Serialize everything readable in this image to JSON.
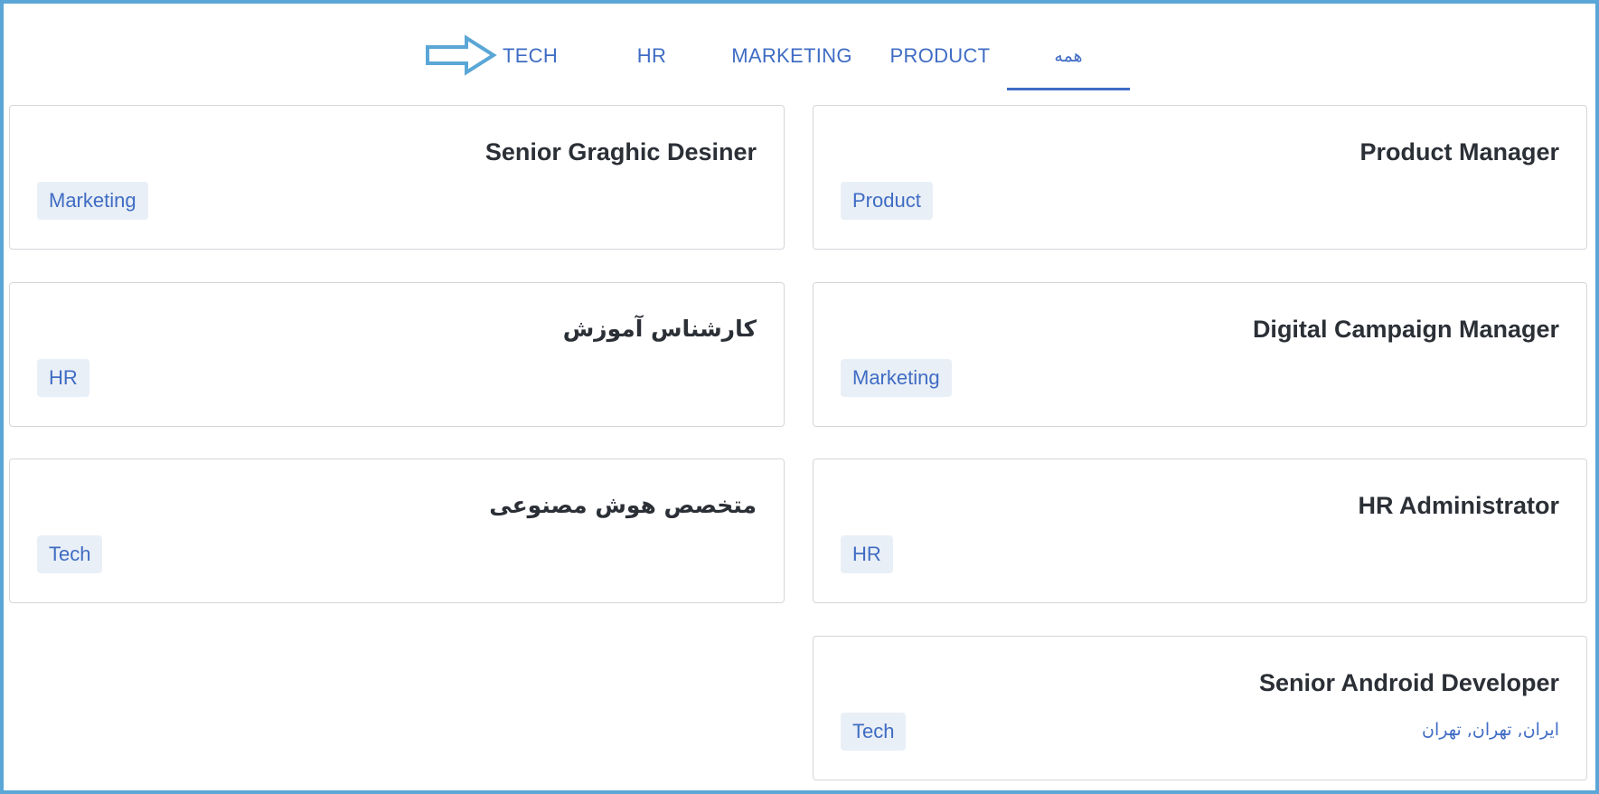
{
  "tabs": [
    {
      "label": "همه",
      "active": true
    },
    {
      "label": "PRODUCT",
      "active": false
    },
    {
      "label": "MARKETING",
      "active": false
    },
    {
      "label": "HR",
      "active": false
    },
    {
      "label": "TECH",
      "active": false
    }
  ],
  "annotation": {
    "icon": "arrow-right-icon",
    "color": "#5aa6d6"
  },
  "jobs": [
    {
      "title": "Product Manager",
      "tag": "Product"
    },
    {
      "title": "Senior Graghic Desiner",
      "tag": "Marketing"
    },
    {
      "title": "Digital Campaign Manager",
      "tag": "Marketing"
    },
    {
      "title": "کارشناس آموزش",
      "tag": "HR"
    },
    {
      "title": "HR Administrator",
      "tag": "HR"
    },
    {
      "title": "متخصص هوش مصنوعی",
      "tag": "Tech"
    },
    {
      "title": "Senior Android Developer",
      "tag": "Tech",
      "location": "ایران, تهران, تهران"
    }
  ],
  "colors": {
    "accent": "#3f6cc4",
    "chip_bg": "#e9eff6",
    "border": "#d4d6da",
    "frame": "#5aa6d6"
  }
}
